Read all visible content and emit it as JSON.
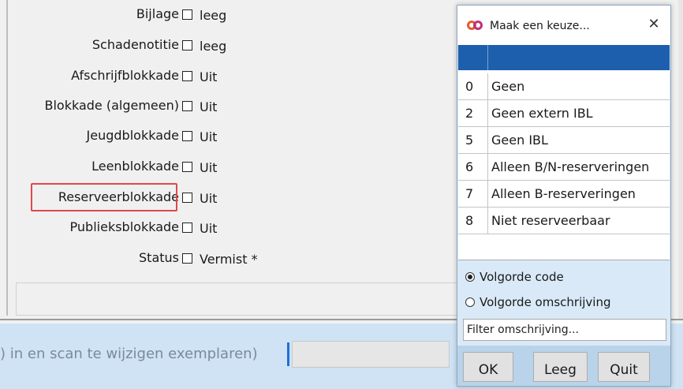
{
  "form": {
    "rows": [
      {
        "label": "Bijlage",
        "value": "leeg"
      },
      {
        "label": "Schadenotitie",
        "value": "leeg"
      },
      {
        "label": "Afschrijfblokkade",
        "value": "Uit"
      },
      {
        "label": "Blokkade (algemeen)",
        "value": "Uit"
      },
      {
        "label": "Jeugdblokkade",
        "value": "Uit"
      },
      {
        "label": "Leenblokkade",
        "value": "Uit"
      },
      {
        "label": "Reserveerblokkade",
        "value": "Uit"
      },
      {
        "label": "Publieksblokkade",
        "value": "Uit"
      },
      {
        "label": "Status",
        "value": "Vermist *"
      }
    ]
  },
  "status_bar": {
    "text": ") in en scan te wijzigen exemplaren)",
    "input_value": ""
  },
  "dialog": {
    "title": "Maak een keuze...",
    "close": "✕",
    "items": [
      {
        "code": "0",
        "desc": "Geen"
      },
      {
        "code": "2",
        "desc": "Geen extern IBL"
      },
      {
        "code": "5",
        "desc": "Geen IBL"
      },
      {
        "code": "6",
        "desc": "Alleen B/N-reserveringen"
      },
      {
        "code": "7",
        "desc": "Alleen B-reserveringen"
      },
      {
        "code": "8",
        "desc": "Niet reserveerbaar"
      }
    ],
    "sort_code": "Volgorde code",
    "sort_desc": "Volgorde omschrijving",
    "filter_placeholder": "Filter omschrijving...",
    "ok": "OK",
    "leeg": "Leeg",
    "quit": "Quit"
  },
  "colors": {
    "list_header": "#1e5fad",
    "highlight": "#e0474c",
    "status_bar": "#cfe3f5"
  }
}
